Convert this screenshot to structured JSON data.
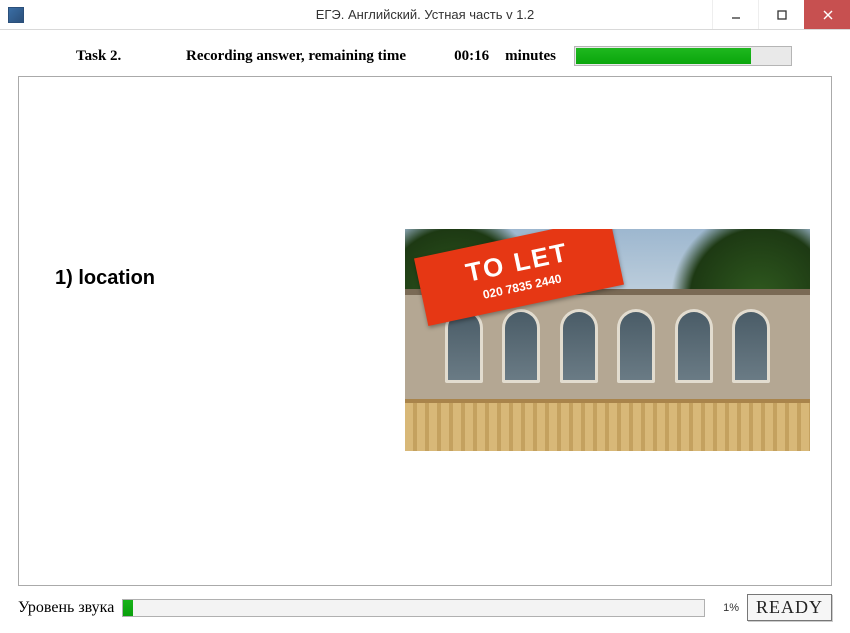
{
  "window": {
    "title": "ЕГЭ. Английский. Устная часть v 1.2"
  },
  "header": {
    "task_label": "Task 2.",
    "status_text": "Recording answer, remaining time",
    "time_value": "00:16",
    "time_unit": "minutes",
    "progress_percent": 82
  },
  "content": {
    "prompt": "1) location",
    "sign_main": "TO LET",
    "sign_sub": "020 7835 2440"
  },
  "footer": {
    "level_label": "Уровень звука",
    "level_percent_text": "1%",
    "ready_label": "READY"
  }
}
